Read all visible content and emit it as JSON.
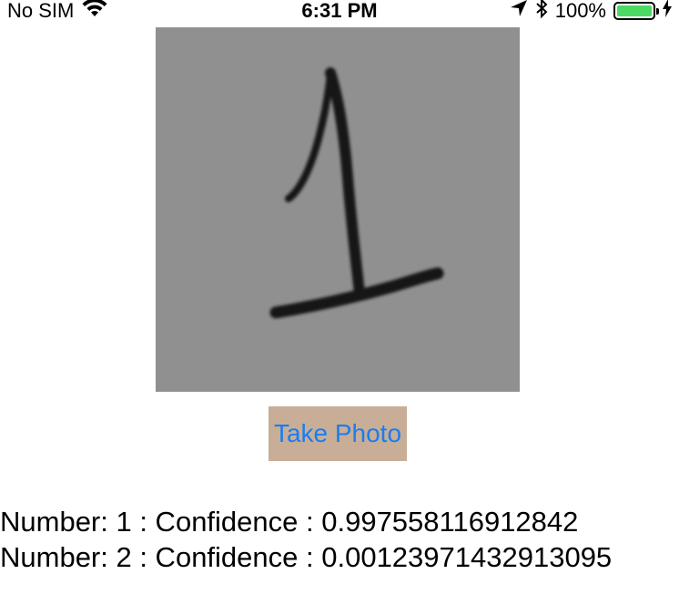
{
  "status_bar": {
    "carrier": "No SIM",
    "time": "6:31 PM",
    "battery_percent": "100%",
    "battery_level": 1.0,
    "icons": [
      "wifi-icon",
      "location-arrow-icon",
      "bluetooth-icon",
      "battery-icon",
      "charging-bolt-icon"
    ]
  },
  "photo": {
    "content": "handwritten digit 1"
  },
  "button": {
    "label": "Take Photo"
  },
  "results": [
    {
      "text": "Number: 1 : Confidence : 0.997558116912842"
    },
    {
      "text": "Number: 2 : Confidence : 0.00123971432913095"
    }
  ],
  "colors": {
    "button_bg": "#c8ae97",
    "button_text": "#1a7df0",
    "battery_fill": "#4cd964",
    "photo_bg": "#8f8f8f"
  }
}
